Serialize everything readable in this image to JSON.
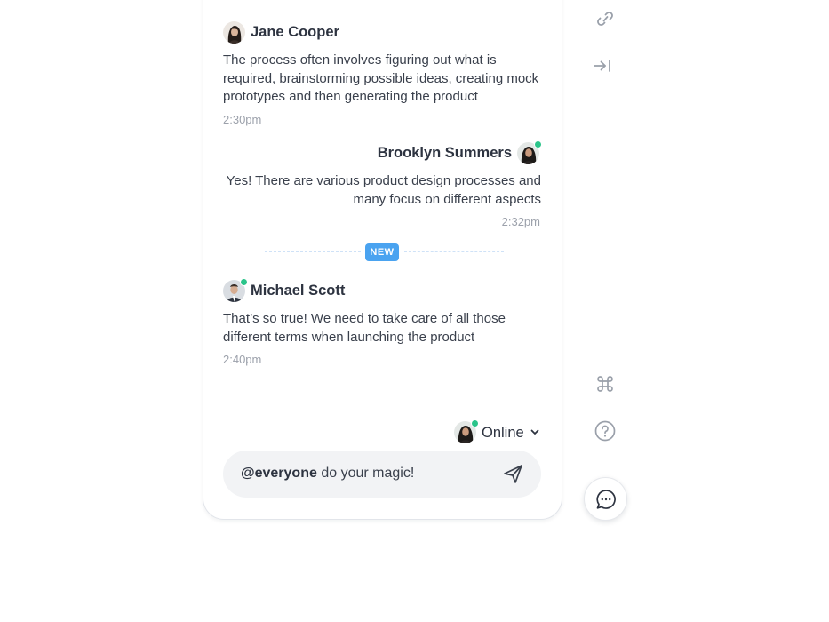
{
  "messages": [
    {
      "sender": "Jane Cooper",
      "text": "The process often involves figuring out what is required, brainstorming possible ideas, creating mock prototypes and then generating the product",
      "time": "2:30pm",
      "online": false
    },
    {
      "sender": "Brooklyn Summers",
      "text": "Yes! There are various product design processes and many focus on different aspects",
      "time": "2:32pm",
      "online": true
    },
    {
      "sender": "Michael Scott",
      "text": "That’s so true! We need to take care of all those different terms when launching the product",
      "time": "2:40pm",
      "online": true
    }
  ],
  "divider": {
    "label": "NEW"
  },
  "status": {
    "label": "Online"
  },
  "composer": {
    "mention": "@everyone",
    "text": "do your magic!"
  },
  "rail_icons": [
    "link-icon",
    "collapse-panel-icon",
    "command-icon",
    "help-icon",
    "chat-icon"
  ],
  "colors": {
    "online_dot": "#2bc48a",
    "new_badge": "#4aa3f0",
    "composer_bg": "#f2f3f5",
    "icon_gray": "#9aa0aa"
  }
}
